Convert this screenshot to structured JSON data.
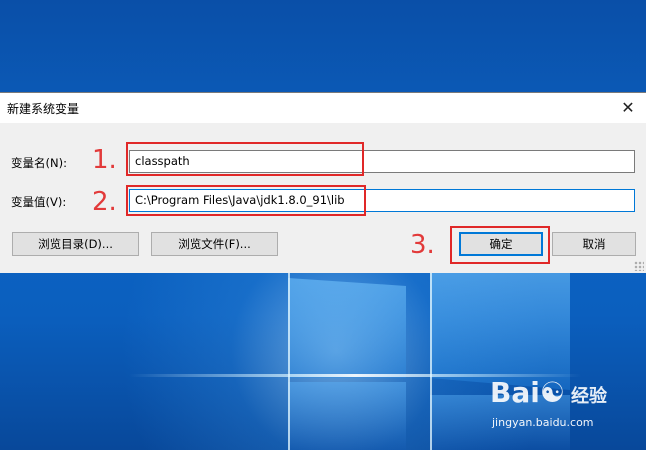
{
  "dialog": {
    "title": "新建系统变量",
    "close_glyph": "✕",
    "name_label": "变量名(N):",
    "name_value": "classpath",
    "value_label": "变量值(V):",
    "value_value": "C:\\Program Files\\Java\\jdk1.8.0_91\\lib",
    "browse_dir_button": "浏览目录(D)...",
    "browse_file_button": "浏览文件(F)...",
    "ok_button": "确定",
    "cancel_button": "取消"
  },
  "annotations": {
    "step1": "1.",
    "step2": "2.",
    "step3": "3.",
    "color": "#e02828"
  },
  "watermark": {
    "brand": "Bai",
    "paw": "☯",
    "brand_suffix": "经验",
    "url": "jingyan.baidu.com"
  },
  "colors": {
    "accent": "#0078d7",
    "desktop": "#0c64c4"
  }
}
